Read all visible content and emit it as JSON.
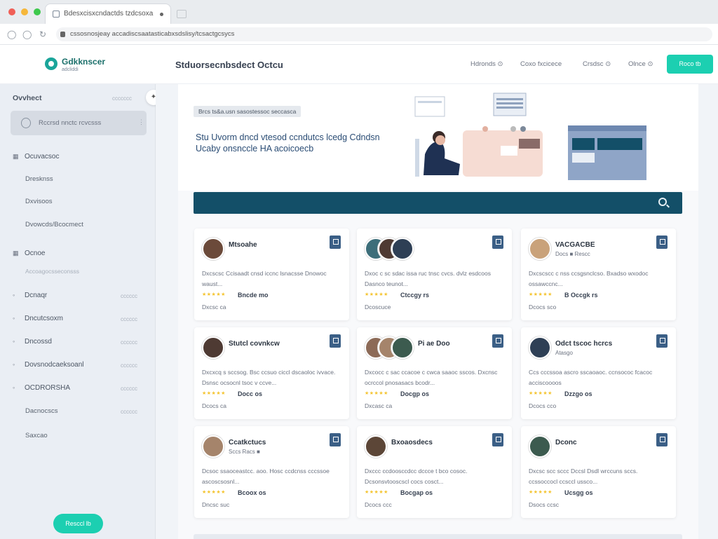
{
  "browser": {
    "tab_title": "Bdesxcisxcndactds tzdcsoxa",
    "url": "cssosnosjeay accadiscsaatasticabxsdslisy/tcsactgcsycs"
  },
  "header": {
    "logo_name": "Gdkknscer",
    "logo_sub": "adcliddi",
    "page_heading": "Stduorsecnbsdect Octcu",
    "nav": [
      "Hdronds ⊙",
      "Coxo fxcicece",
      "Crsdsc ⊙",
      "Olnce ⊙"
    ],
    "cta_label": "Roco tb"
  },
  "sidebar": {
    "heading": "Ovvhect",
    "heading_meta": "ccccccc",
    "pin_icon": "pin-icon",
    "search_label": "Rccrsd nnctc rcvcsss",
    "groups": [
      {
        "icon": "▦",
        "label": "Ocuvacsoc"
      },
      {
        "icon": "",
        "label": "Dresknss",
        "sub": true
      },
      {
        "icon": "",
        "label": "Dxvisoos",
        "sub": true
      },
      {
        "icon": "",
        "label": "Dvowcds/Bcocmect",
        "sub": true
      },
      {
        "icon": "▦",
        "label": "Ocnoe"
      },
      {
        "icon": "",
        "label": "Accoagocsseconsss",
        "sub": true,
        "faint": true
      },
      {
        "icon": "◦",
        "label": "Dcnaqr",
        "meta": "cccccc"
      },
      {
        "icon": "◦",
        "label": "Dncutcsoxm",
        "meta": "cccccc"
      },
      {
        "icon": "◦",
        "label": "Dncossd",
        "meta": "cccccc"
      },
      {
        "icon": "◦",
        "label": "Dovsnodcaeksoanl",
        "meta": "cccccc"
      },
      {
        "icon": "◦",
        "label": "OCDRORSHA",
        "meta": "cccccc"
      },
      {
        "icon": "",
        "label": "Dacnocscs",
        "sub": true,
        "meta": "cccccc"
      },
      {
        "icon": "",
        "label": "Saxcao",
        "sub": true
      }
    ],
    "button_label": "Resccl lb"
  },
  "hero": {
    "chip": "Brcs ts&a.usn sasostessoc seccasca",
    "text": "Stu Uvorm dncd vtesod ccndutcs lcedg Cdndsn Ucaby onsnccle HA acoicoecb"
  },
  "search": {
    "icon": "search-icon"
  },
  "cards": [
    {
      "name": "Mtsoahe",
      "tag": "",
      "desc": "Dxcscsc Ccisaadt cnsd iccnc lsnacsse Dnowoc waust...",
      "stars": "★★★★★",
      "rating": "Bncde mo",
      "count": "Dxcsc ca",
      "avatars": 1
    },
    {
      "name": "",
      "tag": "",
      "desc": "Dxoc c sc sdac issa ruc tnsc cvcs. dvlz esdcoos Dasnco teunot...",
      "stars": "★★★★★",
      "rating": "Ctccgy rs",
      "count": "Dcoscuce",
      "avatars": 3
    },
    {
      "name": "VACGACBE",
      "tag": "Docs ■ Rescc",
      "desc": "Dxcscscc c nss ccsgsnclcso. Bxadso wxodoc ossawccnc...",
      "stars": "★★★★★",
      "rating": "B Occgk rs",
      "count": "Dcocs sco",
      "avatars": 1
    },
    {
      "name": "Stutcl covnkcw",
      "tag": "",
      "desc": "Dxcxcq s sccsog. Bsc ccsuo ciccl dscaoloc ivvace. Dsnsc ocsocnl tsoc v ccve...",
      "stars": "★★★★★",
      "rating": "Docc os",
      "count": "Dcocs ca",
      "avatars": 1
    },
    {
      "name": "Pi ae Doo",
      "tag": "",
      "desc": "Dxcocc c sac ccacoe c cwca saaoc sscos. Dxcnsc ocrccol pnosasacs bcodr...",
      "stars": "★★★★★",
      "rating": "Docgp os",
      "count": "Dxcasc ca",
      "avatars": 3
    },
    {
      "name": "Odct tscoc hcrcs",
      "tag": "Atasgo",
      "desc": "Ccs cccssoa ascro sscaoaoc. ccnsococ fcacoc acciscoooos",
      "stars": "★★★★★",
      "rating": "Dzzgo os",
      "count": "Dcocs cco",
      "avatars": 1
    },
    {
      "name": "Ccatkctucs",
      "tag": "Sccs Racs ■",
      "desc": "Dcsoc ssaoceastcc. aoo. Hosc ccdcnss cccssoe ascoscsosnl...",
      "stars": "★★★★★",
      "rating": "Bcoox os",
      "count": "Dncsc suc",
      "avatars": 1
    },
    {
      "name": "Bxoaosdecs",
      "tag": "",
      "desc": "Dxccc ccdoosccdcc dccce t bco cosoc. Dcsonsvtooscscl cocs cosct...",
      "stars": "★★★★★",
      "rating": "Bocgap os",
      "count": "Dcocs ccc",
      "avatars": 1
    },
    {
      "name": "Dconc",
      "tag": "",
      "desc": "Dxcsc scc sccc Dccsl Dsdl wrccuns sccs. ccssoccocl ccsccl ussco...",
      "stars": "★★★★★",
      "rating": "Ucsgg os",
      "count": "Dsocs ccsc",
      "avatars": 1
    }
  ]
}
